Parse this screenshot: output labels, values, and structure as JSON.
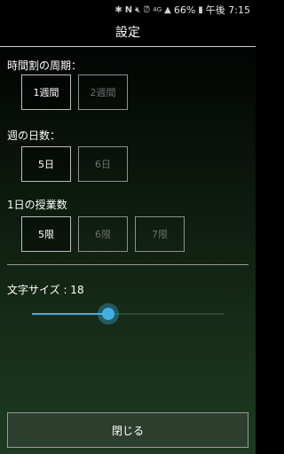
{
  "status": {
    "icons": [
      "bluetooth-icon",
      "nfc-icon",
      "mute-icon",
      "alarm-icon",
      "lte-icon",
      "signal-icon"
    ],
    "battery": "66%",
    "time": "午後 7:15"
  },
  "header": {
    "title": "設定"
  },
  "period": {
    "label": "時間割の周期：",
    "options": [
      "1週間",
      "2週間"
    ],
    "selected": "1週間"
  },
  "days": {
    "label": "週の日数：",
    "options": [
      "5日",
      "6日"
    ],
    "selected": "5日"
  },
  "lessons": {
    "label": "1日の授業数",
    "options": [
      "5限",
      "6限",
      "7限"
    ],
    "selected": "5限"
  },
  "font_size": {
    "label": "文字サイズ : 18",
    "value": 18,
    "fraction": 0.4
  },
  "close_button": {
    "label": "閉じる"
  },
  "colors": {
    "accent": "#3fb0e4",
    "bg_top": "#000000",
    "bg_bottom": "#1d3b20"
  }
}
